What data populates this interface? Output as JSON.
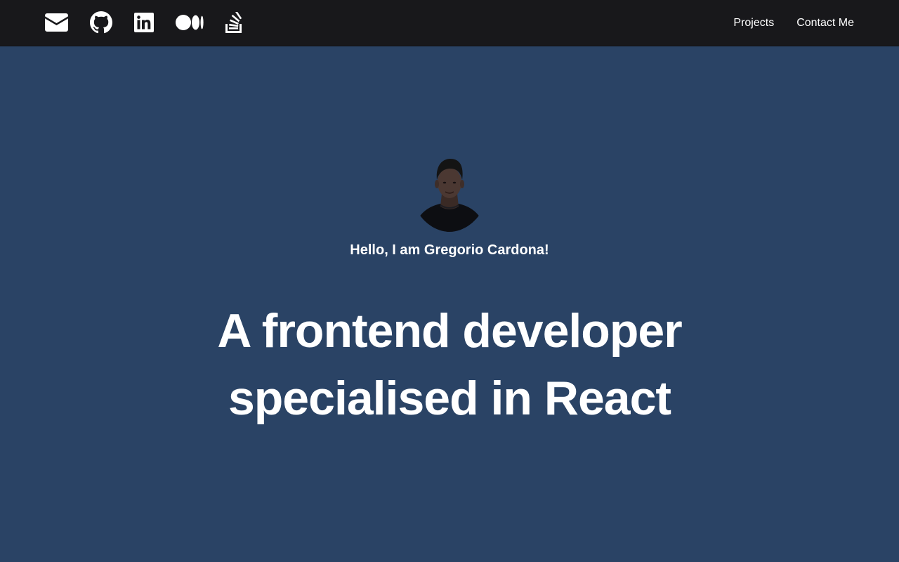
{
  "header": {
    "social_icons": [
      {
        "icon": "envelope-icon"
      },
      {
        "icon": "github-icon"
      },
      {
        "icon": "linkedin-icon"
      },
      {
        "icon": "medium-icon"
      },
      {
        "icon": "stack-overflow-icon"
      }
    ],
    "nav": {
      "projects_label": "Projects",
      "contact_label": "Contact Me"
    }
  },
  "hero": {
    "avatar_icon": "avatar-photo",
    "greeting": "Hello, I am Gregorio Cardona!",
    "headline_line1": "A frontend developer",
    "headline_line2": "specialised in React"
  },
  "colors": {
    "navbar_bg": "#18181b",
    "hero_bg": "#2a4365",
    "text": "#ffffff"
  }
}
